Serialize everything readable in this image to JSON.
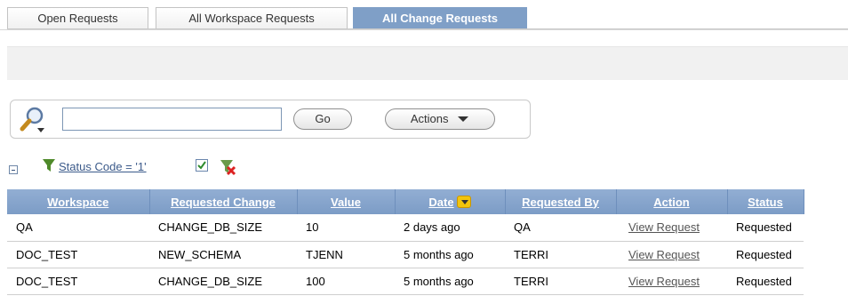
{
  "tabs": [
    {
      "label": "Open Requests",
      "active": false
    },
    {
      "label": "All Workspace Requests",
      "active": false
    },
    {
      "label": "All Change Requests",
      "active": true
    }
  ],
  "search": {
    "value": "",
    "placeholder": "",
    "go_label": "Go",
    "actions_label": "Actions"
  },
  "filter": {
    "label": "Status Code = '1'",
    "enabled": true
  },
  "table": {
    "columns": [
      "Workspace",
      "Requested Change",
      "Value",
      "Date",
      "Requested By",
      "Action",
      "Status"
    ],
    "sorted_column": "Date",
    "rows": [
      {
        "workspace": "QA",
        "change": "CHANGE_DB_SIZE",
        "value": "10",
        "date": "2 days ago",
        "requested_by": "QA",
        "action": "View Request",
        "status": "Requested"
      },
      {
        "workspace": "DOC_TEST",
        "change": "NEW_SCHEMA",
        "value": "TJENN",
        "date": "5 months ago",
        "requested_by": "TERRI",
        "action": "View Request",
        "status": "Requested"
      },
      {
        "workspace": "DOC_TEST",
        "change": "CHANGE_DB_SIZE",
        "value": "100",
        "date": "5 months ago",
        "requested_by": "TERRI",
        "action": "View Request",
        "status": "Requested"
      }
    ]
  },
  "colors": {
    "active_tab": "#7f9fc7",
    "header_bg": "#86a4cc",
    "link": "#3b5a8a"
  },
  "icons": [
    "search-icon",
    "chevron-down-icon",
    "collapse-icon",
    "funnel-icon",
    "checkbox-icon",
    "clear-filter-icon",
    "sort-desc-icon"
  ]
}
